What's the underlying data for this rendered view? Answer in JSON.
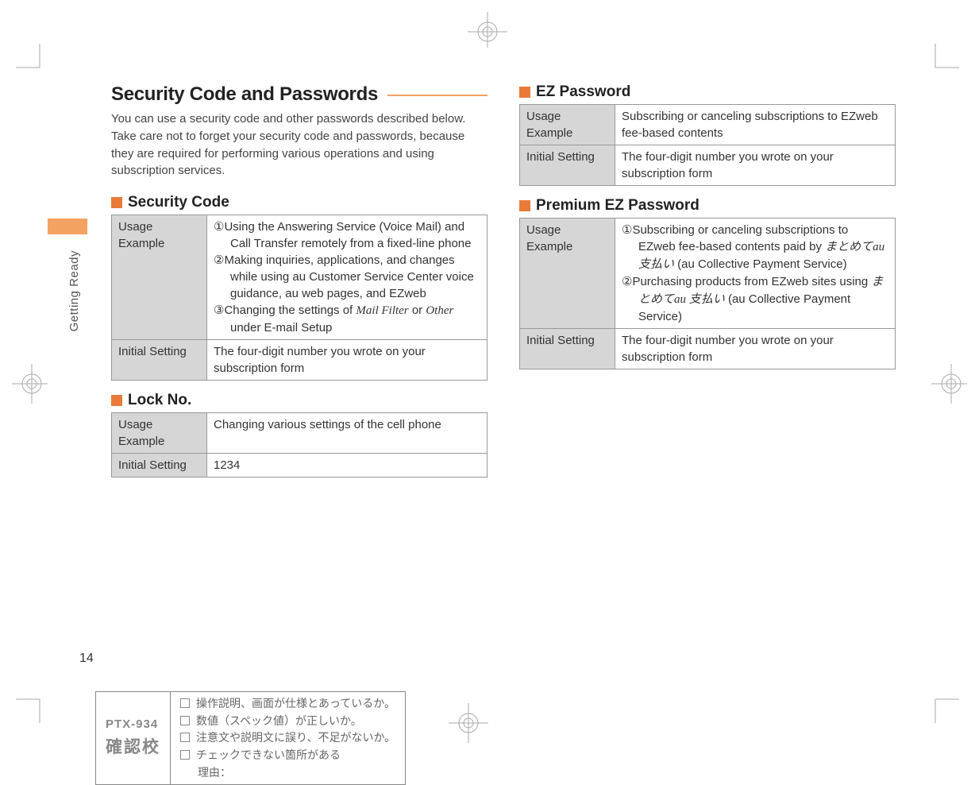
{
  "meta": {
    "section_label": "Getting Ready",
    "page_number": "14"
  },
  "heading": "Security Code and Passwords",
  "intro": "You can use a security code and other passwords described below.\nTake care not to forget your security code and passwords, because they are required for performing various operations and using subscription services.",
  "security_code": {
    "title": "Security Code",
    "rows": {
      "usage_label": "Usage Example",
      "usage_1": "①Using the Answering Service (Voice Mail) and Call Transfer remotely from a fixed-line phone",
      "usage_2": "②Making inquiries, applications, and changes while using au Customer Service Center voice guidance, au web pages, and EZweb",
      "usage_3_pre": "③Changing the settings of ",
      "usage_3_i1": "Mail Filter",
      "usage_3_mid": " or ",
      "usage_3_i2": "Other",
      "usage_3_post": " under E-mail Setup",
      "initial_label": "Initial Setting",
      "initial_value": "The four-digit number you wrote on your subscription form"
    }
  },
  "lock_no": {
    "title": "Lock No.",
    "usage_label": "Usage Example",
    "usage_value": "Changing various settings of the cell phone",
    "initial_label": "Initial Setting",
    "initial_value": "1234"
  },
  "ez_password": {
    "title": "EZ Password",
    "usage_label": "Usage Example",
    "usage_value": "Subscribing or canceling subscriptions to EZweb fee-based contents",
    "initial_label": "Initial Setting",
    "initial_value": "The four-digit number you wrote on your subscription form"
  },
  "premium_ez": {
    "title": "Premium EZ Password",
    "usage_label": "Usage Example",
    "usage_1_pre": "①Subscribing or canceling subscriptions to EZweb fee-based contents paid by ",
    "usage_1_jp": "まとめて",
    "usage_1_au": "au",
    "usage_1_jp2": " 支払い",
    "usage_1_post": " (au Collective Payment Service)",
    "usage_2_pre": "②Purchasing products from EZweb sites using ",
    "usage_2_jp": "まとめて",
    "usage_2_au": "au",
    "usage_2_jp2": " 支払い",
    "usage_2_post": " (au Collective Payment Service)",
    "initial_label": "Initial Setting",
    "initial_value": "The four-digit number you wrote on your subscription form"
  },
  "proof": {
    "model": "PTX-934",
    "kakunin": "確認校",
    "line1": "操作説明、画面が仕様とあっているか。",
    "line2": "数値（スペック値）が正しいか。",
    "line3": "注意文や説明文に誤り、不足がないか。",
    "line4": "チェックできない箇所がある",
    "line5": "理由："
  }
}
